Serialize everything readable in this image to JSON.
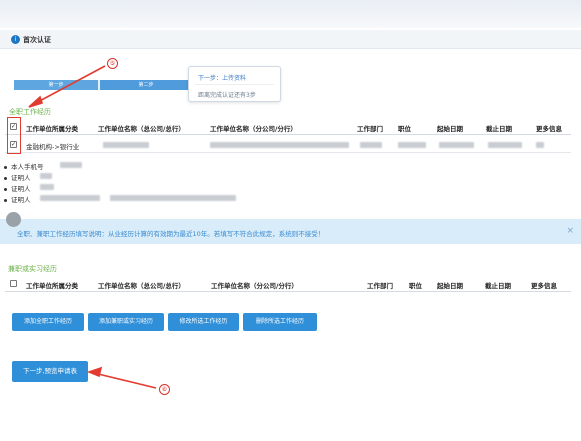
{
  "page": {
    "title": "首次认证",
    "title_icon": "info-icon"
  },
  "steps": [
    {
      "label": "第一步"
    },
    {
      "label": "第二步"
    }
  ],
  "tooltip": {
    "next": "下一步：上传资料",
    "remaining": "距离完成认证还有3步"
  },
  "callouts": {
    "five": "⑤",
    "six": "⑥"
  },
  "fulltime": {
    "title": "全职工作经历",
    "columns": [
      "工作单位所属分类",
      "工作单位名称（总公司/总行）",
      "工作单位名称（分公司/分行）",
      "工作部门",
      "职位",
      "起始日期",
      "截止日期",
      "更多信息"
    ],
    "rows": [
      {
        "category": "金融机构->银行业",
        "checked": true
      }
    ],
    "header_checked": true
  },
  "info": {
    "phone_label": "本人手机号",
    "witness1": "证明人",
    "witness2": "证明人",
    "witness3": "证明人"
  },
  "notice": {
    "text": "全职、兼职工作经历填写说明：从业经历计算的有效期为最近10年。若填写不符合此规定，系统则不接受！",
    "close": "×"
  },
  "parttime": {
    "title": "兼职或实习经历",
    "columns": [
      "工作单位所属分类",
      "工作单位名称（总公司/总行）",
      "工作单位名称（分公司/分行）",
      "工作部门",
      "职位",
      "起始日期",
      "截止日期",
      "更多信息"
    ]
  },
  "buttons": {
    "add_fulltime": "添加全职工作经历",
    "add_parttime": "添加兼职或实习经历",
    "edit_selected": "修改所选工作经历",
    "delete_selected": "删除所选工作经历",
    "next": "下一步,预览申请表"
  },
  "colors": {
    "accent": "#2f8fd8",
    "section_green": "#6bb24a",
    "annotation_red": "#e23b2f",
    "notice_bg": "#d9ecf9"
  }
}
